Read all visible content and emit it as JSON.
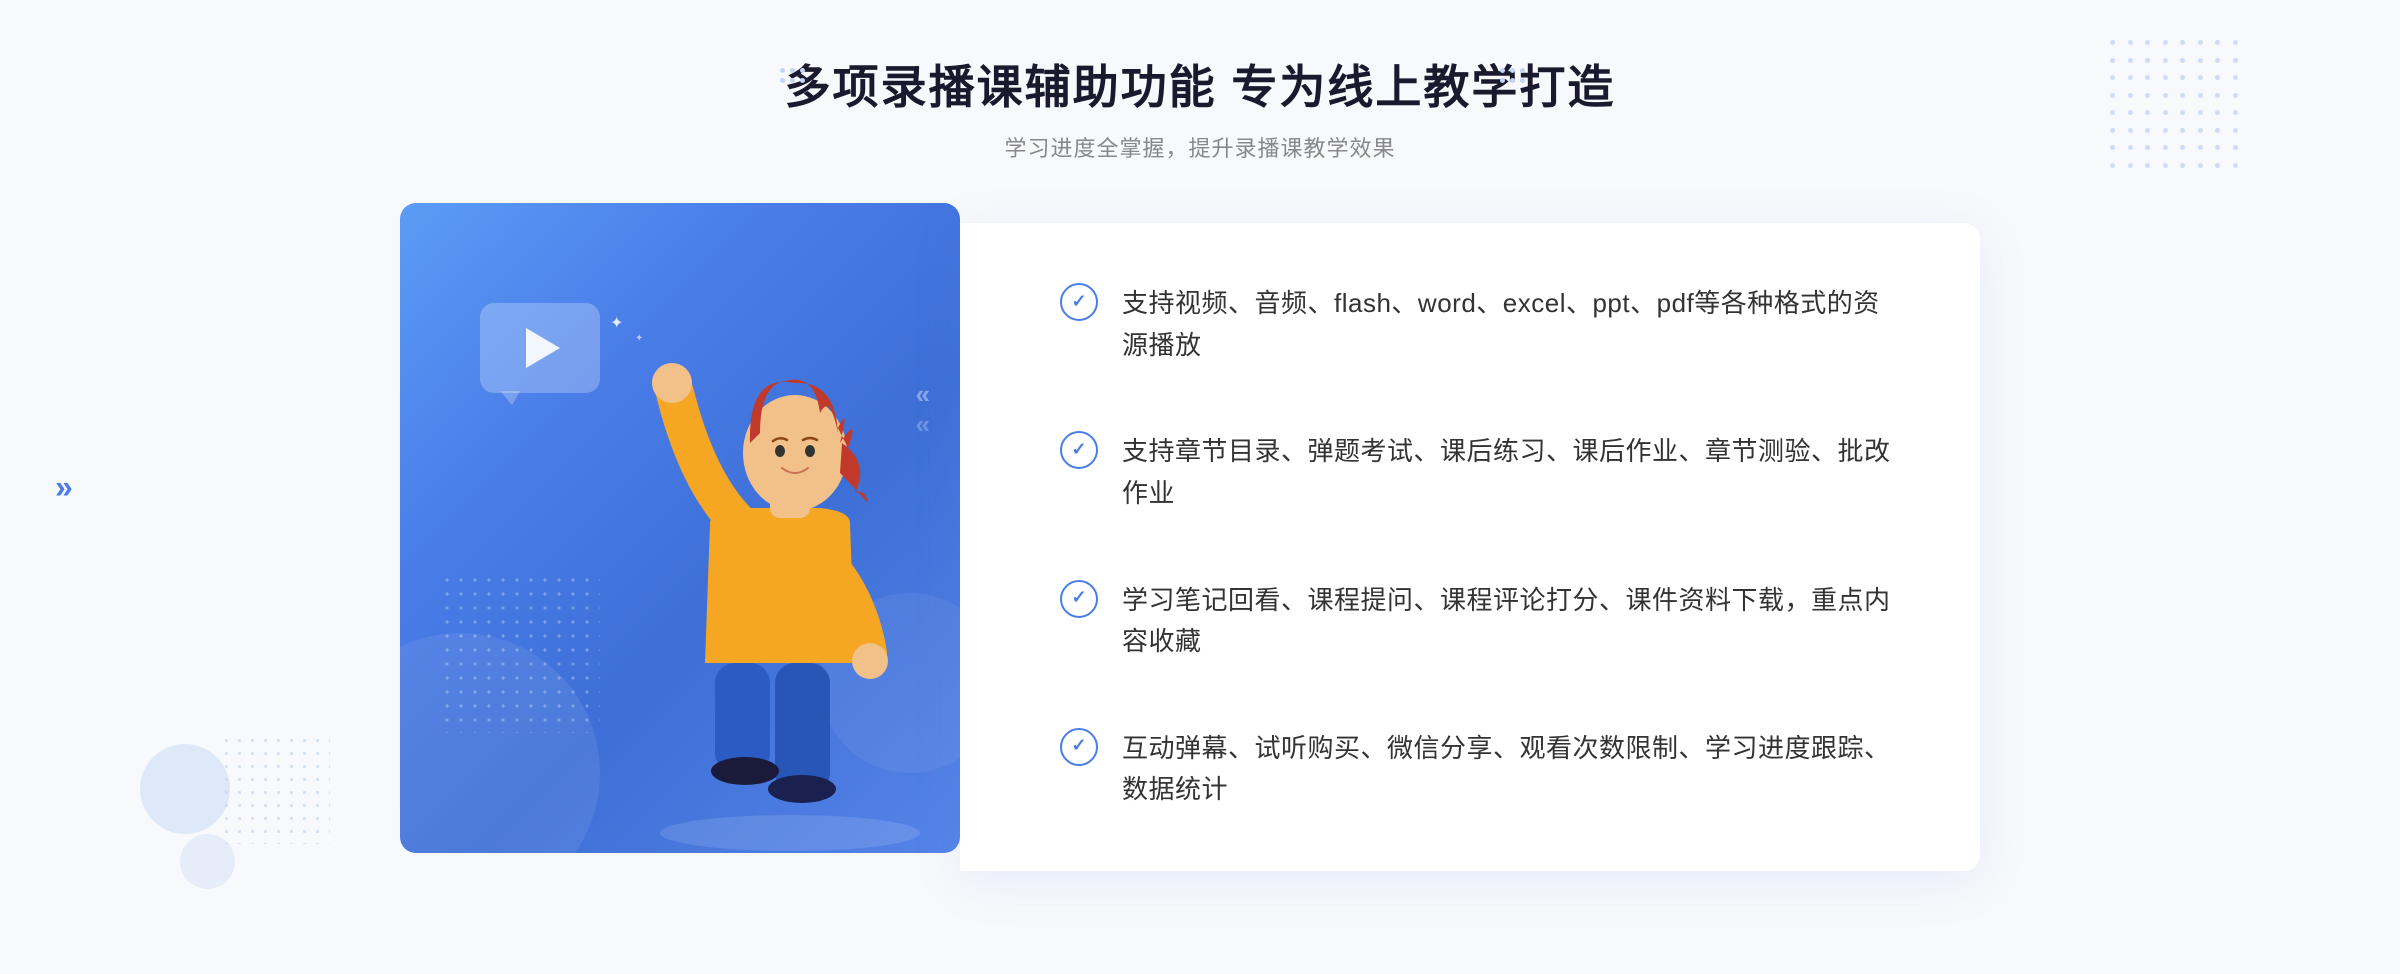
{
  "header": {
    "main_title": "多项录播课辅助功能 专为线上教学打造",
    "sub_title": "学习进度全掌握，提升录播课教学效果"
  },
  "features": [
    {
      "id": 1,
      "text": "支持视频、音频、flash、word、excel、ppt、pdf等各种格式的资源播放"
    },
    {
      "id": 2,
      "text": "支持章节目录、弹题考试、课后练习、课后作业、章节测验、批改作业"
    },
    {
      "id": 3,
      "text": "学习笔记回看、课程提问、课程评论打分、课件资料下载，重点内容收藏"
    },
    {
      "id": 4,
      "text": "互动弹幕、试听购买、微信分享、观看次数限制、学习进度跟踪、数据统计"
    }
  ],
  "icons": {
    "check": "✓",
    "play": "▶",
    "arrow_right": "»",
    "sparkle": "✦"
  },
  "colors": {
    "primary_blue": "#4a7de8",
    "light_blue": "#5b9cf6",
    "text_dark": "#1a1a2e",
    "text_gray": "#888888",
    "text_feature": "#333333",
    "white": "#ffffff",
    "bg_light": "#f8f9fc"
  }
}
